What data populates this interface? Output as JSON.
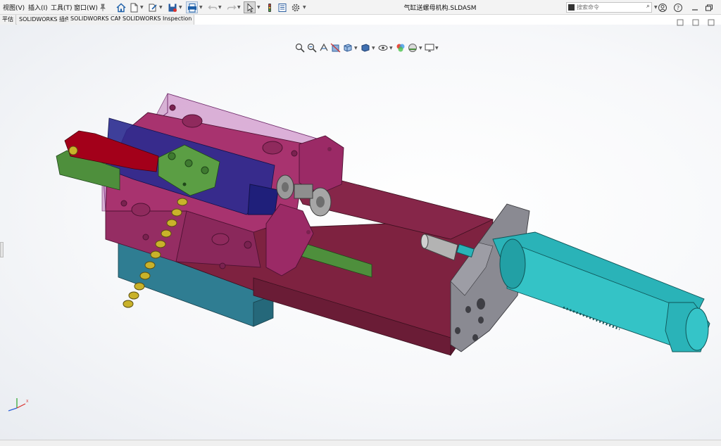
{
  "menu": {
    "items": [
      {
        "label": "视图(V)"
      },
      {
        "label": "插入(I)"
      },
      {
        "label": "工具(T)"
      },
      {
        "label": "窗口(W)"
      }
    ]
  },
  "title": "气缸送螺母机构.SLDASM",
  "search": {
    "placeholder": "搜索命令"
  },
  "tabs": [
    {
      "label": "平估"
    },
    {
      "label": "SOLIDWORKS 插件"
    },
    {
      "label": "SOLIDWORKS CAM"
    },
    {
      "label": "SOLIDWORKS Inspection"
    }
  ],
  "colors": {
    "base_plate": "#7e2240",
    "magenta_block": "#a8336f",
    "transparent_block": "#c77fc0",
    "blue_slider": "#2a2a8f",
    "green_bar": "#4e8f3c",
    "red_finger": "#a3001a",
    "teal_base": "#2f7d92",
    "cylinder": "#2ab3b8",
    "bracket_gray": "#8a8a92",
    "nut": "#b9a926"
  },
  "icons": [
    "home-icon",
    "new-icon",
    "open-icon",
    "save-icon",
    "print-icon",
    "undo-icon",
    "redo-icon",
    "select-icon",
    "rebuild-icon",
    "file-properties-icon",
    "options-icon",
    "search-icon",
    "user-icon",
    "help-icon",
    "minimize-icon",
    "restore-icon"
  ]
}
